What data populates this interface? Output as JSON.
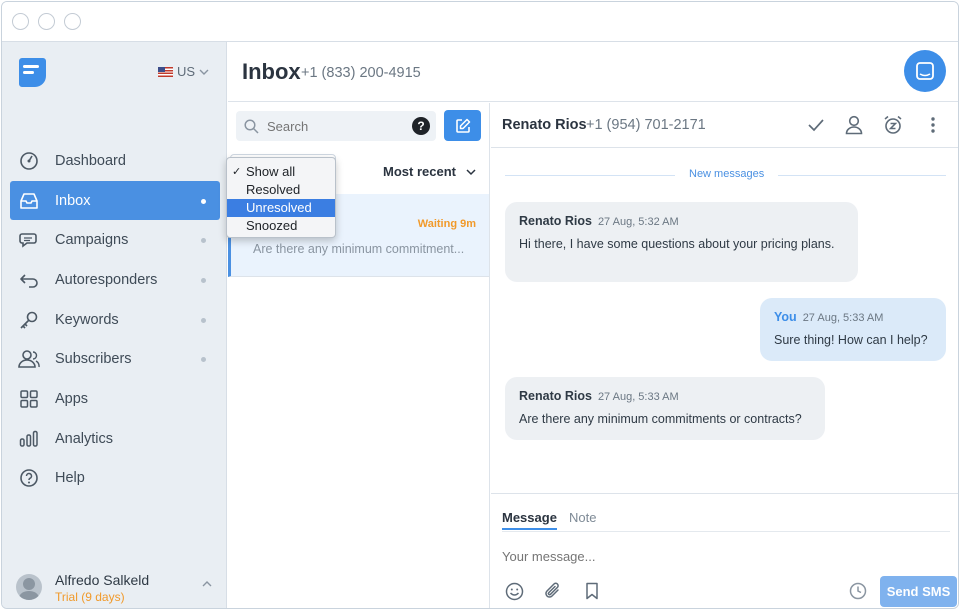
{
  "sidebar": {
    "country": "US",
    "nav": [
      {
        "label": "Dashboard",
        "icon": "dashboard-icon"
      },
      {
        "label": "Inbox",
        "icon": "inbox-icon"
      },
      {
        "label": "Campaigns",
        "icon": "campaigns-icon"
      },
      {
        "label": "Autoresponders",
        "icon": "autoresponders-icon"
      },
      {
        "label": "Keywords",
        "icon": "key-icon"
      },
      {
        "label": "Subscribers",
        "icon": "subscribers-icon"
      },
      {
        "label": "Apps",
        "icon": "apps-icon"
      },
      {
        "label": "Analytics",
        "icon": "analytics-icon"
      },
      {
        "label": "Help",
        "icon": "help-icon"
      }
    ],
    "user": {
      "name": "Alfredo Salkeld",
      "plan": "Trial (9 days)"
    }
  },
  "header": {
    "title": "Inbox",
    "phone": "+1 (833) 200-4915"
  },
  "list": {
    "search_placeholder": "Search",
    "help_badge": "?",
    "sort_label": "Most recent",
    "filter_options": [
      {
        "label": "Show all",
        "checked": true
      },
      {
        "label": "Resolved"
      },
      {
        "label": "Unresolved",
        "highlighted": true
      },
      {
        "label": "Snoozed"
      }
    ],
    "conversation": {
      "status": "Waiting 9m",
      "preview": "Are there any minimum commitment..."
    }
  },
  "chat": {
    "contact_name": "Renato Rios",
    "contact_phone": "+1 (954) 701-2171",
    "divider": "New messages",
    "messages": [
      {
        "author": "Renato Rios",
        "time": "27 Aug, 5:32 AM",
        "text": "Hi there, I have some questions about your pricing plans."
      },
      {
        "author": "You",
        "time": "27 Aug, 5:33 AM",
        "text": "Sure thing! How can I help?"
      },
      {
        "author": "Renato Rios",
        "time": "27 Aug, 5:33 AM",
        "text": "Are there any minimum commitments or contracts?"
      }
    ],
    "composer": {
      "tab_message": "Message",
      "tab_note": "Note",
      "placeholder": "Your message...",
      "send_label": "Send SMS"
    }
  },
  "colors": {
    "accent": "#4a90e2",
    "warning": "#f19a2b",
    "sidebar_bg": "#e9eef3"
  }
}
